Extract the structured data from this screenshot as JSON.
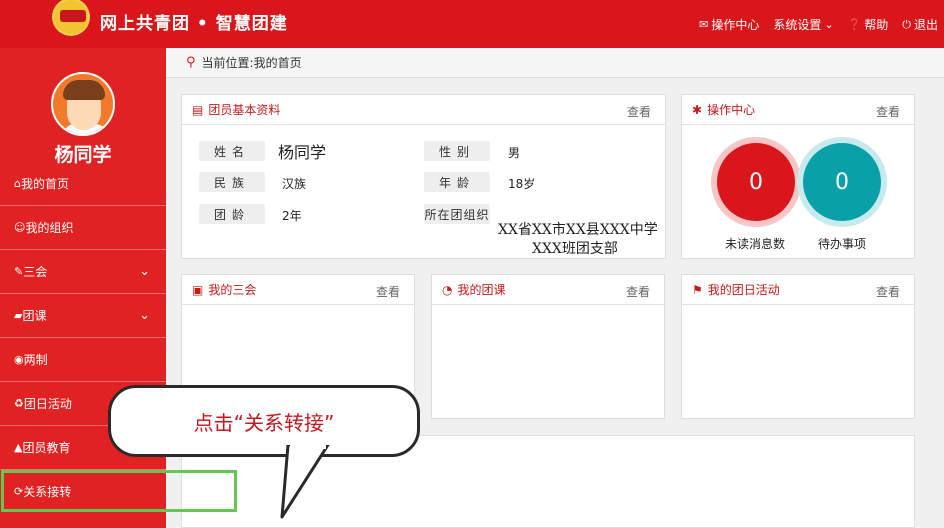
{
  "header": {
    "title": "网上共青团 • 智慧团建",
    "nav": [
      {
        "label": "操作中心",
        "icon": "envelope-icon"
      },
      {
        "label": "系统设置",
        "icon": "chevron-down-icon"
      },
      {
        "label": "帮助",
        "icon": "question-icon"
      },
      {
        "label": "退出",
        "icon": "power-icon"
      }
    ]
  },
  "sidebar": {
    "user_name": "杨同学",
    "items": [
      {
        "label": "我的首页",
        "icon": "home-icon"
      },
      {
        "label": "我的组织",
        "icon": "users-icon"
      },
      {
        "label": "三会",
        "icon": "edit-icon",
        "expandable": true
      },
      {
        "label": "团课",
        "icon": "folder-icon",
        "expandable": true
      },
      {
        "label": "两制",
        "icon": "circle-dot-icon"
      },
      {
        "label": "团日活动",
        "icon": "recycle-icon"
      },
      {
        "label": "团员教育",
        "icon": "graduation-cap-icon"
      },
      {
        "label": "关系接转",
        "icon": "refresh-icon"
      }
    ]
  },
  "breadcrumb": "当前位置:我的首页",
  "profile": {
    "title": "团员基本资料",
    "view": "查看",
    "fields": {
      "name_label": "姓名",
      "name": "杨同学",
      "gender_label": "性别",
      "gender": "男",
      "ethnicity_label": "民族",
      "ethnicity": "汉族",
      "age_label": "年龄",
      "age": "18岁",
      "league_age_label": "团龄",
      "league_age": "2年",
      "org_label": "所在团组织",
      "org_line1": "XX省XX市XX县XXX中学",
      "org_line2": "XXX班团支部"
    }
  },
  "ops": {
    "title": "操作中心",
    "view": "查看",
    "unread_count": "0",
    "unread_label": "未读消息数",
    "todo_count": "0",
    "todo_label": "待办事项"
  },
  "panels": {
    "sanhui": {
      "title": "我的三会",
      "view": "查看"
    },
    "tuanke": {
      "title": "我的团课",
      "view": "查看"
    },
    "activity": {
      "title": "我的团日活动",
      "view": "查看"
    }
  },
  "callout": "点击“关系转接”",
  "colors": {
    "primary": "#d9161b",
    "sidebar": "#e12222",
    "highlight": "#61c94f"
  }
}
